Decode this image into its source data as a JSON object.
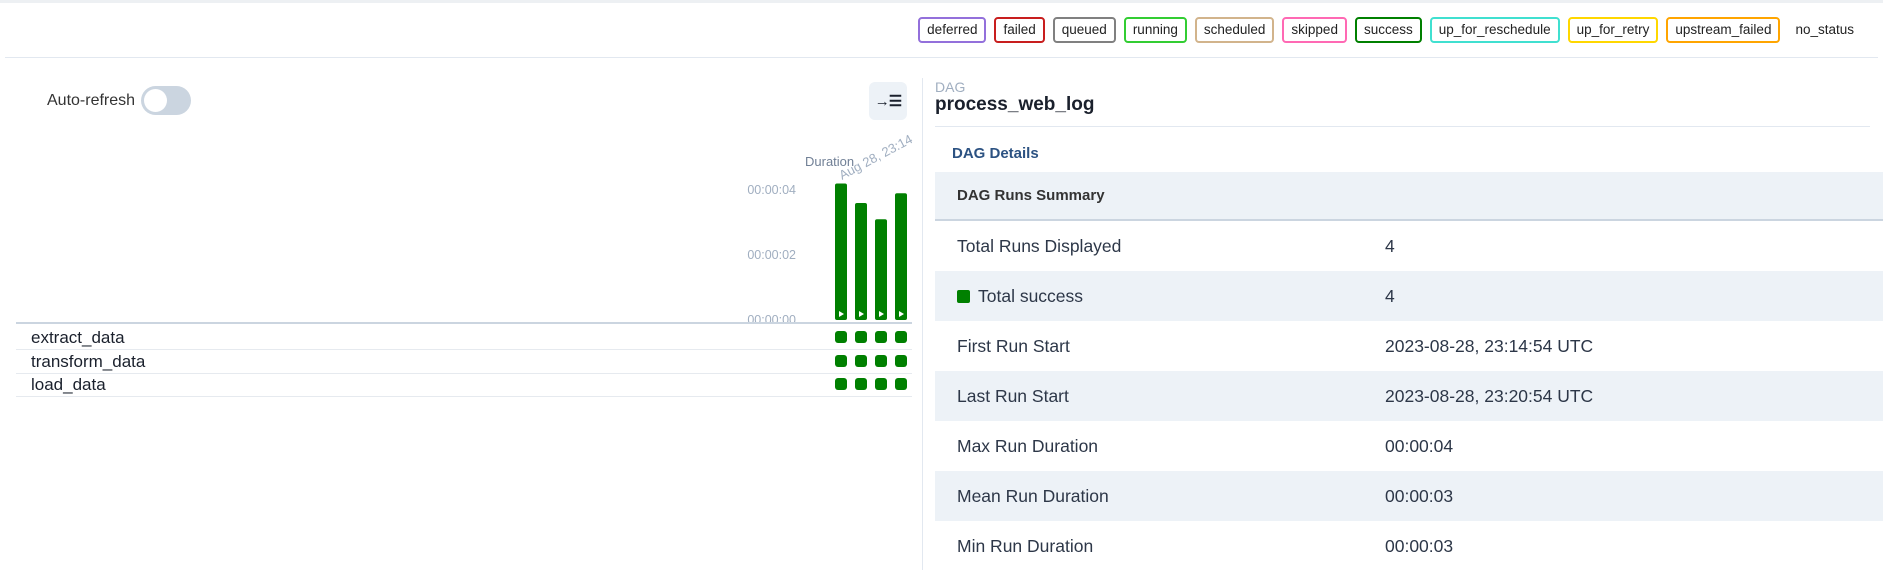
{
  "legend": [
    {
      "label": "deferred",
      "color": "#9370db"
    },
    {
      "label": "failed",
      "color": "#c81e1e"
    },
    {
      "label": "queued",
      "color": "#808080"
    },
    {
      "label": "running",
      "color": "#32cd32"
    },
    {
      "label": "scheduled",
      "color": "#d2b48c"
    },
    {
      "label": "skipped",
      "color": "#ff69b4"
    },
    {
      "label": "success",
      "color": "#008000"
    },
    {
      "label": "up_for_reschedule",
      "color": "#40e0d0"
    },
    {
      "label": "up_for_retry",
      "color": "#ffd700"
    },
    {
      "label": "upstream_failed",
      "color": "#ffa500"
    },
    {
      "label": "no_status",
      "color": ""
    }
  ],
  "grid": {
    "auto_refresh_label": "Auto-refresh",
    "auto_refresh_on": false,
    "duration_label": "Duration",
    "first_run_label": "Aug 28, 23:14",
    "y_ticks": [
      "00:00:04",
      "00:00:02",
      "00:00:00"
    ],
    "run_durations_sec": [
      4.2,
      3.6,
      3.1,
      3.9
    ],
    "run_state": "success",
    "success_color": "#008000",
    "tasks": [
      {
        "name": "extract_data",
        "states": [
          "success",
          "success",
          "success",
          "success"
        ]
      },
      {
        "name": "transform_data",
        "states": [
          "success",
          "success",
          "success",
          "success"
        ]
      },
      {
        "name": "load_data",
        "states": [
          "success",
          "success",
          "success",
          "success"
        ]
      }
    ],
    "collapse_icon": "arrow-to-list-icon"
  },
  "details": {
    "dag_label": "DAG",
    "dag_id": "process_web_log",
    "tab": "DAG Details",
    "summary_title": "DAG Runs Summary",
    "rows": [
      {
        "key": "Total Runs Displayed",
        "value": "4"
      },
      {
        "key": "Total success",
        "value": "4",
        "swatch": true
      },
      {
        "key": "First Run Start",
        "value": "2023-08-28, 23:14:54 UTC"
      },
      {
        "key": "Last Run Start",
        "value": "2023-08-28, 23:20:54 UTC"
      },
      {
        "key": "Max Run Duration",
        "value": "00:00:04"
      },
      {
        "key": "Mean Run Duration",
        "value": "00:00:03"
      },
      {
        "key": "Min Run Duration",
        "value": "00:00:03"
      }
    ]
  }
}
